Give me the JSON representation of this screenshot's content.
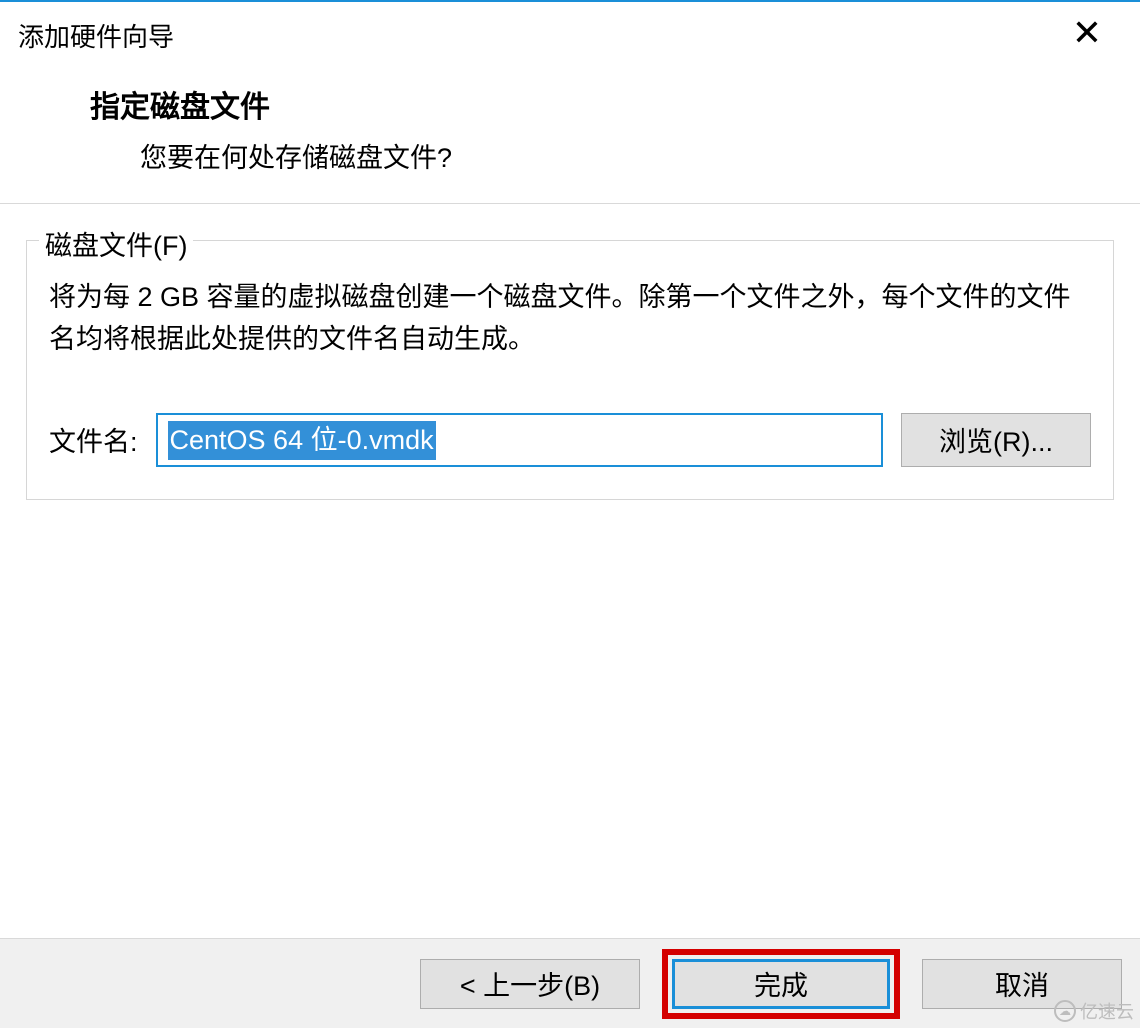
{
  "window": {
    "title": "添加硬件向导",
    "close_icon": "✕"
  },
  "header": {
    "title": "指定磁盘文件",
    "subtitle": "您要在何处存储磁盘文件?"
  },
  "group": {
    "legend": "磁盘文件(F)",
    "description": "将为每 2 GB 容量的虚拟磁盘创建一个磁盘文件。除第一个文件之外，每个文件的文件名均将根据此处提供的文件名自动生成。",
    "file_label": "文件名:",
    "file_value": "CentOS 64 位-0.vmdk",
    "browse_label": "浏览(R)..."
  },
  "footer": {
    "back": "< 上一步(B)",
    "finish": "完成",
    "cancel": "取消"
  },
  "watermark": {
    "text": "亿速云"
  }
}
